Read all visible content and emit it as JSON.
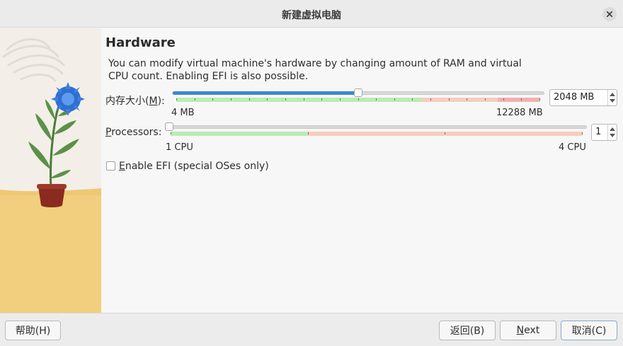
{
  "window": {
    "title": "新建虚拟电脑"
  },
  "page": {
    "heading": "Hardware",
    "description": "You can modify virtual machine's hardware by changing amount of RAM and virtual CPU count. Enabling EFI is also possible."
  },
  "memory": {
    "label_prefix": "内存大小(",
    "label_mnemonic": "M",
    "label_suffix": "):",
    "value": "2048 MB",
    "value_mb": 2048,
    "min_label": "4 MB",
    "max_label": "12288 MB",
    "min_mb": 4,
    "max_mb": 12288
  },
  "processors": {
    "label_mnemonic": "P",
    "label_rest": "rocessors:",
    "value": "1",
    "min_label": "1 CPU",
    "max_label": "4 CPU",
    "min_cpu": 1,
    "max_cpu": 4,
    "current_cpu": 1
  },
  "efi": {
    "label_mnemonic": "E",
    "label_rest": "nable EFI (special OSes only)",
    "checked": false
  },
  "buttons": {
    "help": "帮助(H)",
    "back": "返回(B)",
    "next_mnemonic": "N",
    "next_rest": "ext",
    "cancel": "取消(C)"
  },
  "colors": {
    "slider_fill": "#3d86d4",
    "scale_green": "#b9ecb4",
    "scale_orange": "#f6cdbf",
    "scale_red": "#f2b0b0"
  },
  "icons": {
    "close": "close-icon",
    "illustration": "plant-illustration"
  }
}
